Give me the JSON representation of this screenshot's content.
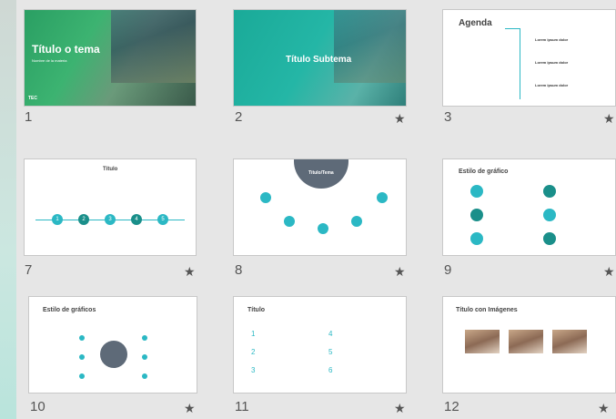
{
  "slides": [
    {
      "number": "1",
      "title": "Título o tema",
      "subtitle": "Nombre de la materia",
      "logo": "TEC"
    },
    {
      "number": "2",
      "title": "Título Subtema"
    },
    {
      "number": "3",
      "title": "Agenda",
      "items": [
        "Lorem ipsum dolor",
        "Lorem ipsum dolor",
        "Lorem ipsum dolor"
      ]
    },
    {
      "number": "7",
      "title": "Título",
      "steps": [
        "1",
        "2",
        "3",
        "4",
        "5"
      ]
    },
    {
      "number": "8",
      "title": "Título/Tema"
    },
    {
      "number": "9",
      "title": "Estilo de gráfico"
    },
    {
      "number": "10",
      "title": "Estilo de gráficos"
    },
    {
      "number": "11",
      "title": "Título",
      "items": [
        "1",
        "2",
        "3",
        "4",
        "5",
        "6"
      ]
    },
    {
      "number": "12",
      "title": "Título con Imágenes"
    }
  ],
  "star_glyph": "★",
  "lorem": "Lorem ipsum dolor sit amet",
  "colors": {
    "accent": "#2bb8c4",
    "dark": "#1a8f8a",
    "circle": "#5e6a78"
  }
}
